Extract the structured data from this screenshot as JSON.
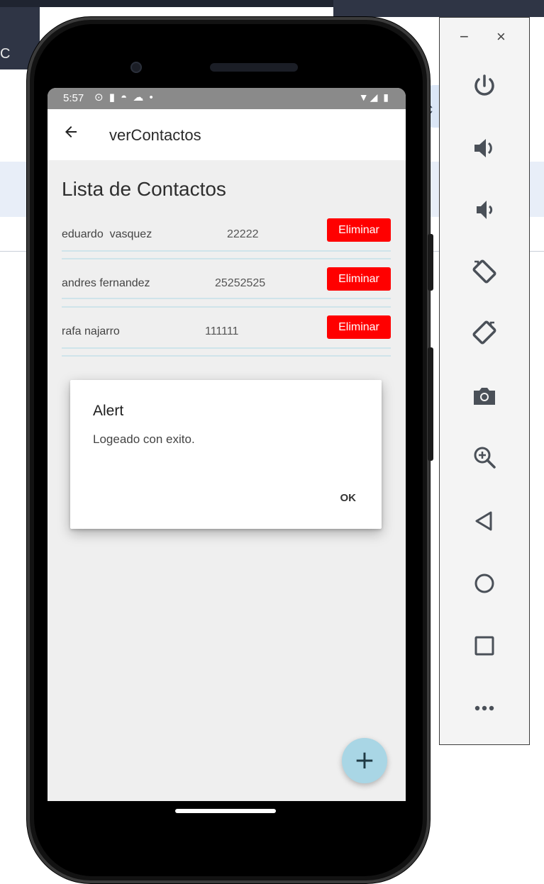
{
  "background": {
    "left_partial_text": "C",
    "right_partial_text": "c"
  },
  "status_bar": {
    "time": "5:57",
    "left_icons": "⊙ ▮ ◓ ☁ •",
    "right_icons": "▼◢ ▮"
  },
  "app_bar": {
    "back_icon": "arrow-left",
    "title": "verContactos"
  },
  "list_title": "Lista de Contactos",
  "contacts": [
    {
      "name": "eduardo  vasquez",
      "phone": "22222",
      "delete_label": "Eliminar"
    },
    {
      "name": "andres fernandez",
      "phone": "25252525",
      "delete_label": "Eliminar"
    },
    {
      "name": "rafa najarro",
      "phone": "111111",
      "delete_label": "Eliminar"
    }
  ],
  "dialog": {
    "title": "Alert",
    "message": "Logeado con exito.",
    "ok_label": "OK"
  },
  "fab": {
    "icon": "plus",
    "label": "+"
  },
  "emulator_panel": {
    "minimize": "−",
    "close": "×",
    "buttons": [
      "power-icon",
      "volume-up-icon",
      "volume-down-icon",
      "rotate-left-icon",
      "rotate-right-icon",
      "camera-icon",
      "zoom-icon",
      "back-icon",
      "home-icon",
      "overview-icon",
      "more-icon"
    ]
  },
  "colors": {
    "delete_button": "#ff0000",
    "fab": "#a9d6e5",
    "status_bar": "#8a8a8a",
    "screen_background": "#efefef",
    "row_divider": "#cfe4ea"
  }
}
